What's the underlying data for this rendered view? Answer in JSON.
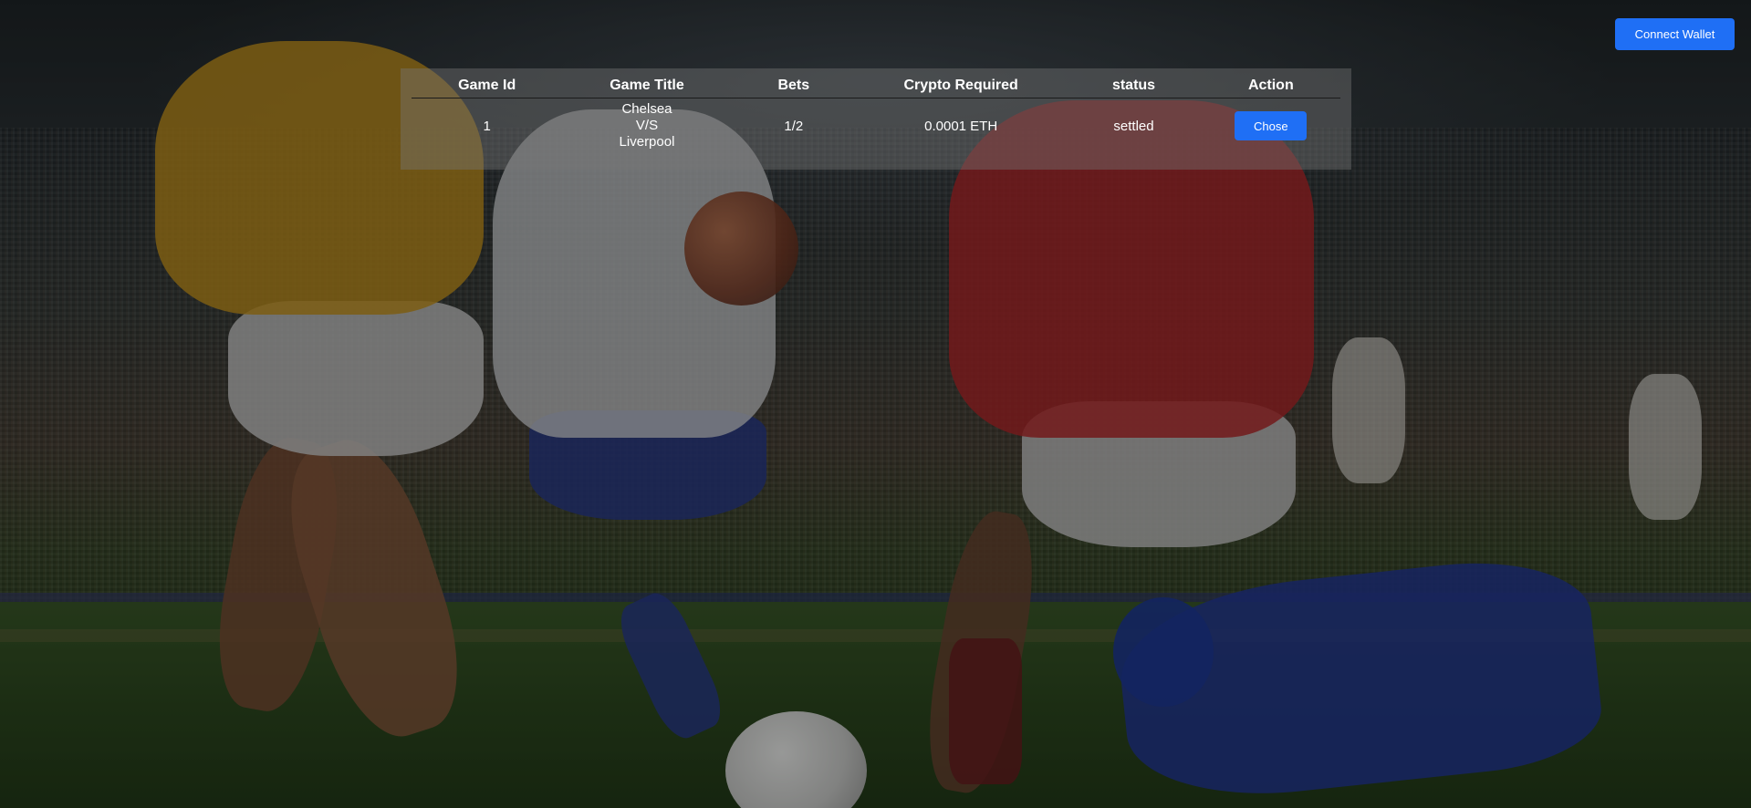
{
  "header": {
    "connect_wallet_label": "Connect Wallet"
  },
  "table": {
    "columns": [
      "Game Id",
      "Game Title",
      "Bets",
      "Crypto Required",
      "status",
      "Action"
    ],
    "rows": [
      {
        "game_id": "1",
        "title_line1": "Chelsea",
        "title_line2": "V/S",
        "title_line3": "Liverpool",
        "bets": "1/2",
        "crypto_required": "0.0001 ETH",
        "status": "settled",
        "action_label": "Chose"
      }
    ]
  },
  "colors": {
    "button_blue": "#1f6ff5",
    "panel_overlay": "rgba(120,120,120,0.42)"
  },
  "background": {
    "description_icon": "football-stadium-photo"
  }
}
